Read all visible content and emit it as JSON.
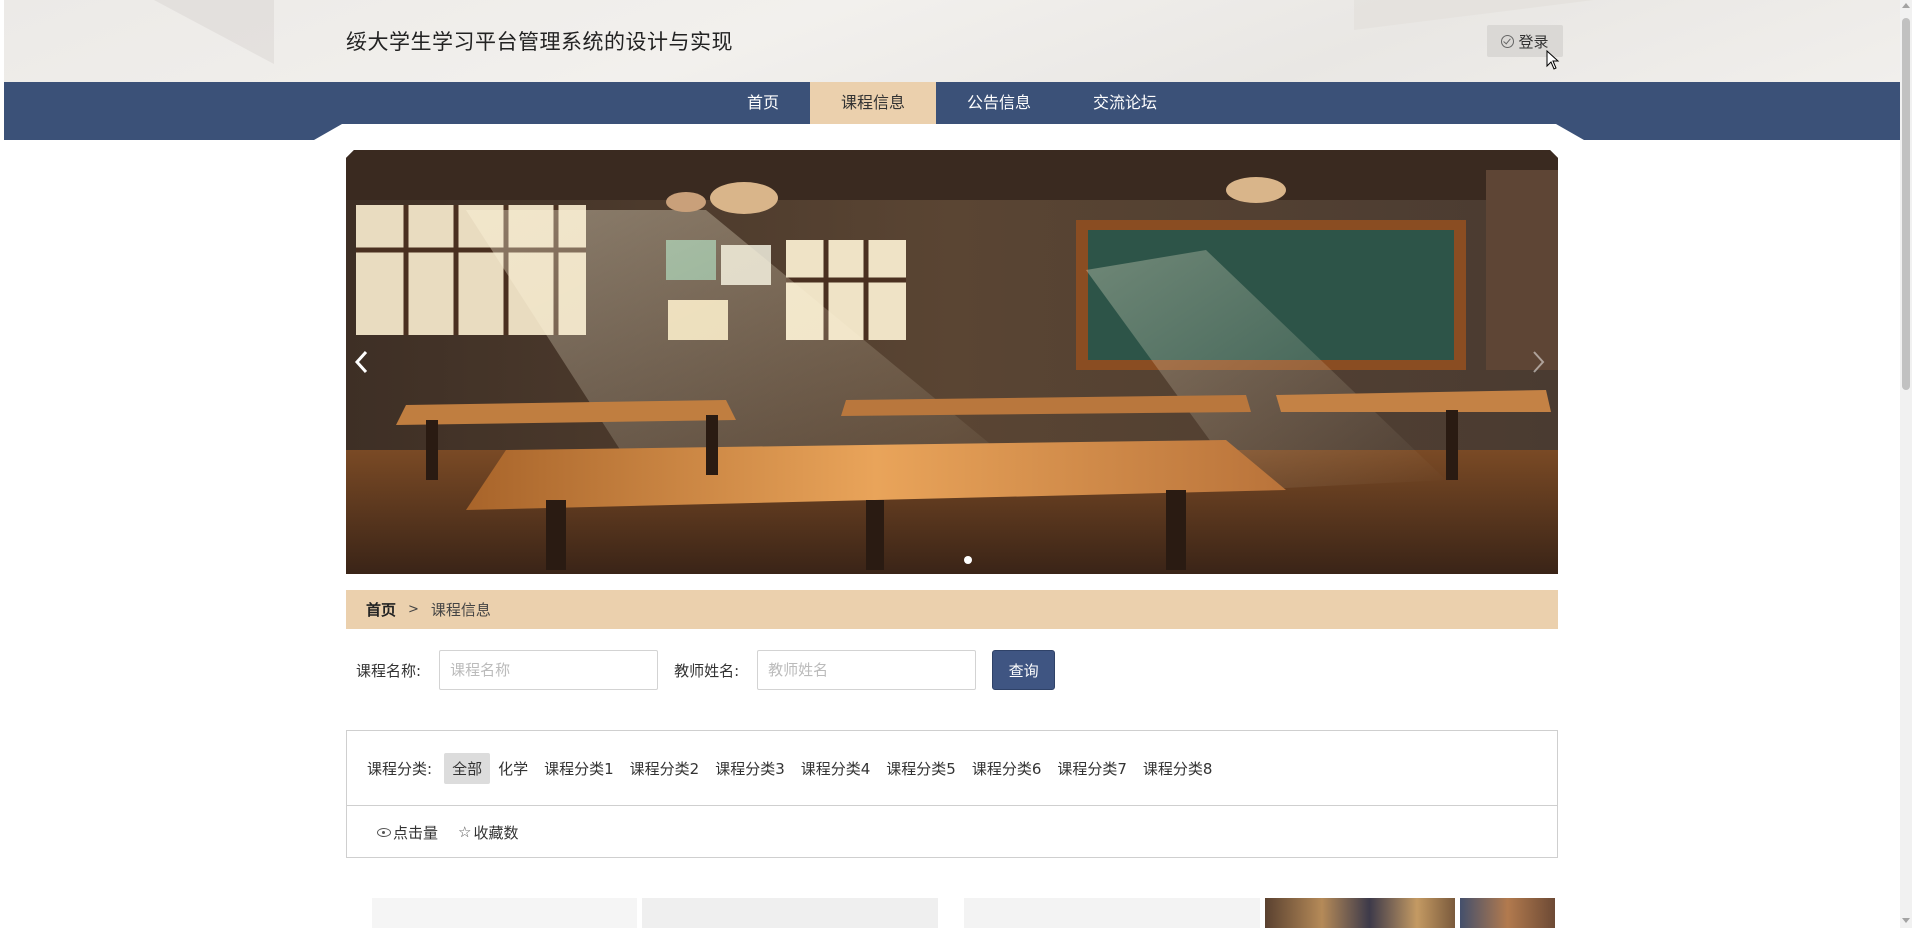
{
  "header": {
    "site_title": "绥大学生学习平台管理系统的设计与实现",
    "login_label": "登录"
  },
  "nav": {
    "items": [
      {
        "label": "首页",
        "active": false
      },
      {
        "label": "课程信息",
        "active": true
      },
      {
        "label": "公告信息",
        "active": false
      },
      {
        "label": "交流论坛",
        "active": false
      }
    ]
  },
  "banner": {
    "prev_icon": "chevron-left-icon",
    "next_icon": "chevron-right-icon",
    "slide_count": 1,
    "active_slide": 1
  },
  "breadcrumb": {
    "home": "首页",
    "separator": ">",
    "current": "课程信息"
  },
  "search": {
    "course_name_label": "课程名称:",
    "course_name_placeholder": "课程名称",
    "course_name_value": "",
    "teacher_name_label": "教师姓名:",
    "teacher_name_placeholder": "教师姓名",
    "teacher_name_value": "",
    "query_label": "查询"
  },
  "categories": {
    "label": "课程分类:",
    "items": [
      "全部",
      "化学",
      "课程分类1",
      "课程分类2",
      "课程分类3",
      "课程分类4",
      "课程分类5",
      "课程分类6",
      "课程分类7",
      "课程分类8"
    ],
    "active_index": 0
  },
  "sort": {
    "clicks_label": "点击量",
    "favorites_label": "收藏数"
  },
  "colors": {
    "nav_bg": "#3b5178",
    "accent": "#ebd0ad",
    "button_bg": "#3f5582"
  }
}
